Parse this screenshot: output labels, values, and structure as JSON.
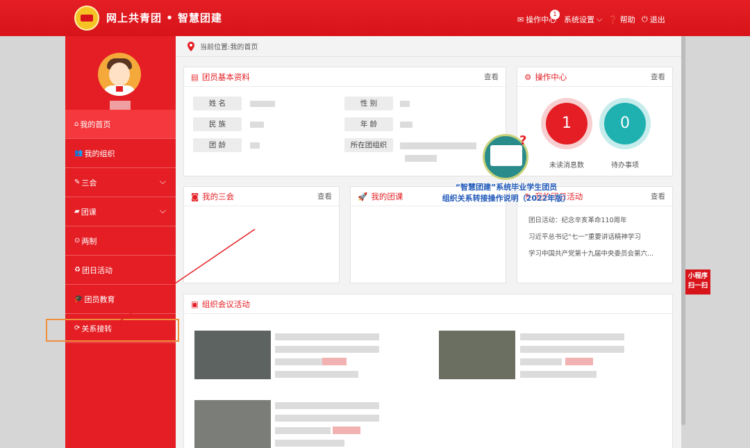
{
  "header": {
    "title": "网上共青团 • 智慧团建",
    "nav": [
      {
        "icon": "mail-icon",
        "label": "操作中心",
        "badge": "1"
      },
      {
        "icon": "chevron-down-icon",
        "label": "系统设置"
      },
      {
        "icon": "help-icon",
        "label": "帮助"
      },
      {
        "icon": "power-icon",
        "label": "退出"
      }
    ]
  },
  "sidebar": {
    "items": [
      {
        "label": "我的首页",
        "icon": "home-icon",
        "active": true
      },
      {
        "label": "我的组织",
        "icon": "users-icon"
      },
      {
        "label": "三会",
        "icon": "edit-icon",
        "expandable": true
      },
      {
        "label": "团课",
        "icon": "folder-icon",
        "expandable": true
      },
      {
        "label": "两制",
        "icon": "target-icon"
      },
      {
        "label": "团日活动",
        "icon": "recycle-icon"
      },
      {
        "label": "团员教育",
        "icon": "graduation-cap-icon"
      },
      {
        "label": "关系接转",
        "icon": "refresh-icon",
        "highlighted": true
      }
    ]
  },
  "breadcrumb": "当前位置:我的首页",
  "profile": {
    "title": "团员基本资料",
    "more": "查看",
    "fields": [
      {
        "label": "姓 名"
      },
      {
        "label": "民 族"
      },
      {
        "label": "团 龄"
      },
      {
        "label": "性 别"
      },
      {
        "label": "年 龄"
      },
      {
        "label": "所在团组织"
      }
    ]
  },
  "ops": {
    "title": "操作中心",
    "more": "查看",
    "unread": {
      "value": "1",
      "label": "未读消息数"
    },
    "todo": {
      "value": "0",
      "label": "待办事项"
    }
  },
  "meetings": {
    "title": "我的三会",
    "more": "查看"
  },
  "courses": {
    "title": "我的团课"
  },
  "activities": {
    "title": "我的团日活动",
    "more": "查看",
    "items": [
      "团日活动：纪念辛亥革命110周年",
      "习近平总书记“七一”重要讲话精神学习",
      "学习中国共产党第十九届中央委员会第六..."
    ]
  },
  "org_meetings": {
    "title": "组织会议活动"
  },
  "overlay": {
    "line1": "“智慧团建”系统毕业学生团员",
    "line2": "组织关系转接操作说明（2022年版）"
  },
  "mini_program": {
    "line1": "小程序",
    "line2": "扫一扫"
  },
  "colors": {
    "brand_red": "#e41e24",
    "teal": "#1fb0b0",
    "highlight_orange": "#ef8f3e"
  }
}
